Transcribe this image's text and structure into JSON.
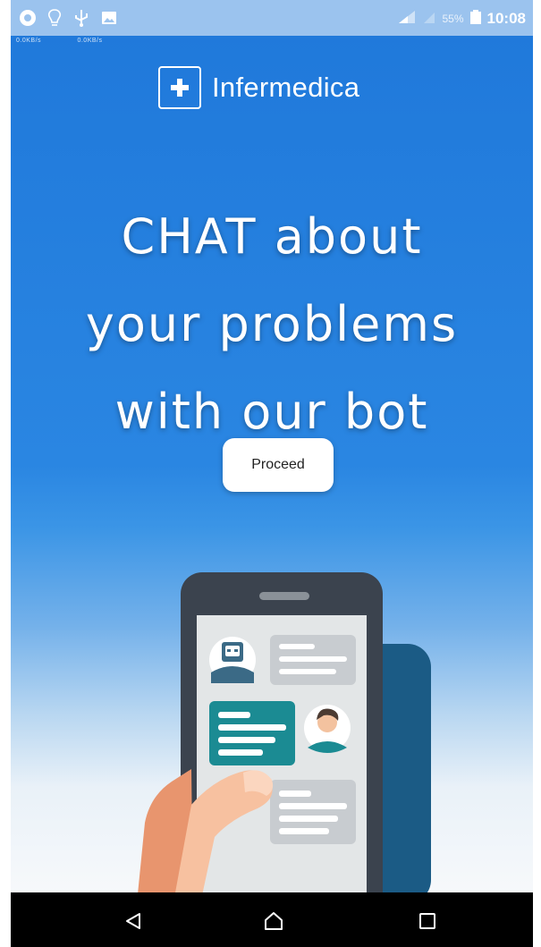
{
  "status_bar": {
    "left_icons": [
      "chrome-icon",
      "bulb-icon",
      "usb-icon",
      "image-icon"
    ],
    "speeds": [
      "0.0KB/s",
      "0.0KB/s"
    ],
    "battery_text": "55%",
    "time": "10:08"
  },
  "brand": {
    "name": "Infermedica",
    "icon": "plus-icon"
  },
  "headline": {
    "line1": "CHAT about",
    "line2": "your problems",
    "line3": "with our bot"
  },
  "proceed_button": {
    "label": "Proceed"
  },
  "nav_bar": {
    "icons": [
      "back-icon",
      "home-icon",
      "recents-icon"
    ]
  },
  "colors": {
    "background_top": "#1f78da",
    "background_bottom": "#f7f9fb",
    "status_bar": "#9bc3ee",
    "phone_body": "#3b434e",
    "phone_screen": "#e3e6e7",
    "bubble_teal": "#1b8b93",
    "bubble_gray": "#c8ccd0",
    "back_panel": "#1b5b85",
    "hand": "#f7c1a0"
  }
}
